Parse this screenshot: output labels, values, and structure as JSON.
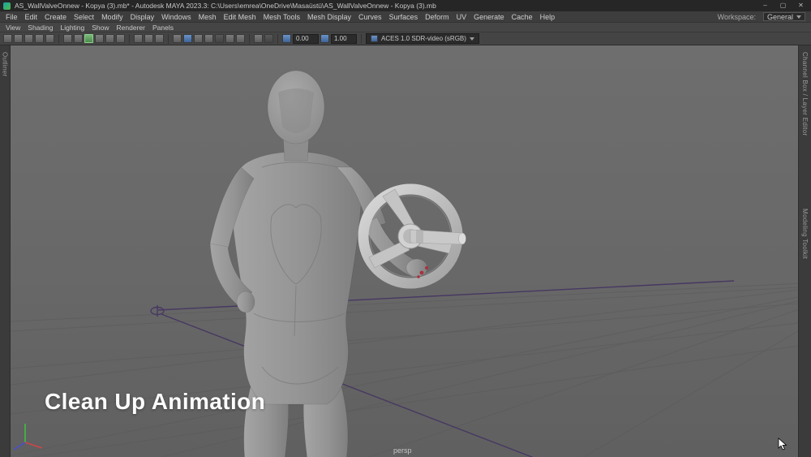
{
  "window": {
    "title": "AS_WallValveOnnew - Kopya (3).mb* - Autodesk MAYA 2023.3: C:\\Users\\emrea\\OneDrive\\Masaüstü\\AS_WallValveOnnew - Kopya (3).mb",
    "minimize": "–",
    "maximize": "▢",
    "close": "✕"
  },
  "menubar": {
    "items": [
      "File",
      "Edit",
      "Create",
      "Select",
      "Modify",
      "Display",
      "Windows",
      "Mesh",
      "Edit Mesh",
      "Mesh Tools",
      "Mesh Display",
      "Curves",
      "Surfaces",
      "Deform",
      "UV",
      "Generate",
      "Cache",
      "Help"
    ],
    "workspace_label": "Workspace:",
    "workspace_value": "General"
  },
  "panel_menu": {
    "items": [
      "View",
      "Shading",
      "Lighting",
      "Show",
      "Renderer",
      "Panels"
    ]
  },
  "panel_toolbar": {
    "exposure": "0.00",
    "gamma": "1.00",
    "view_transform": "ACES 1.0 SDR-video (sRGB)"
  },
  "side_panels": {
    "left_tab": "Outliner",
    "right_tabs": [
      "Channel Box / Layer Editor",
      "Modeling Toolkit"
    ]
  },
  "viewport": {
    "camera": "persp",
    "overlay_text": "Clean Up Animation"
  },
  "colors": {
    "active_icon_green": "#4c8a4c",
    "icon_blue": "#3e6398",
    "control_curve_purple": "#473862",
    "axis_x_red": "#d04545",
    "axis_y_green": "#3fbf3f",
    "axis_z_blue": "#4550d0",
    "viewport_gray_top": "#6e6e6e",
    "viewport_gray_bottom": "#606060"
  }
}
